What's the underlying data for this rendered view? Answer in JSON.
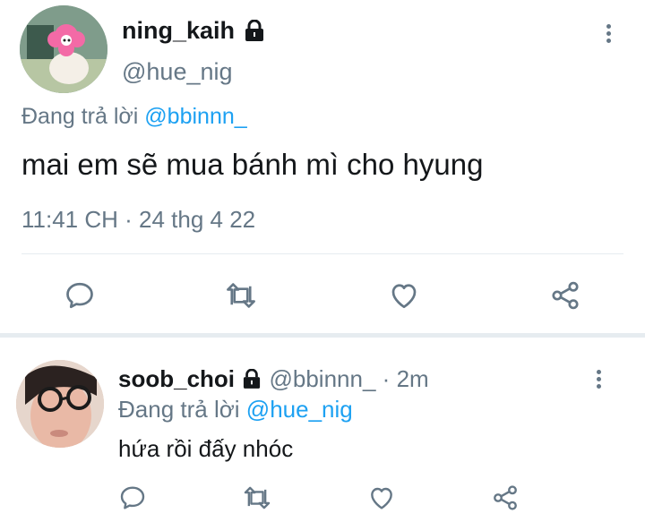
{
  "main_tweet": {
    "display_name": "ning_kaih",
    "handle": "@hue_nig",
    "reply_prefix": "Đang trả lời",
    "reply_to": "@bbinnn_",
    "text": "mai em sẽ mua bánh mì cho hyung",
    "timestamp": "11:41 CH · 24 thg 4 22",
    "avatar_colors": {
      "bg": "#8fa99a",
      "accent": "#f36aa6",
      "dark": "#2a3a33"
    }
  },
  "reply_tweet": {
    "display_name": "soob_choi",
    "handle": "@bbinnn_",
    "time_sep": "·",
    "time": "2m",
    "reply_prefix": "Đang trả lời",
    "reply_to": "@hue_nig",
    "text": "hứa rồi đấy nhóc",
    "avatar_colors": {
      "bg": "#d9c1b3",
      "accent": "#2b2b2b"
    }
  },
  "icons": [
    "lock-icon",
    "more-icon",
    "reply-icon",
    "retweet-icon",
    "like-icon",
    "share-icon"
  ],
  "colors": {
    "link": "#1da1f2",
    "muted": "#657786",
    "text": "#14171a",
    "divider": "#e6ecf0"
  }
}
